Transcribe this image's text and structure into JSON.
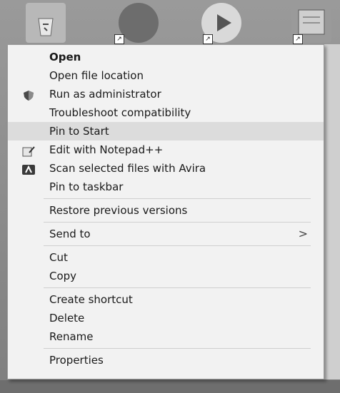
{
  "desktop": {
    "icons": [
      "recycle-bin-icon",
      "app-shortcut-icon",
      "media-shortcut-icon",
      "document-shortcut-icon"
    ]
  },
  "context_menu": {
    "items": [
      {
        "label": "Open"
      },
      {
        "label": "Open file location"
      },
      {
        "label": "Run as administrator",
        "icon": "shield-icon"
      },
      {
        "label": "Troubleshoot compatibility"
      },
      {
        "label": "Pin to Start"
      },
      {
        "label": "Edit with Notepad++",
        "icon": "notepad-plus-plus-icon"
      },
      {
        "label": "Scan selected files with Avira",
        "icon": "avira-icon"
      },
      {
        "label": "Pin to taskbar"
      },
      {
        "label": "Restore previous versions"
      },
      {
        "label": "Send to",
        "submenu_arrow": ">"
      },
      {
        "label": "Cut"
      },
      {
        "label": "Copy"
      },
      {
        "label": "Create shortcut"
      },
      {
        "label": "Delete"
      },
      {
        "label": "Rename"
      },
      {
        "label": "Properties"
      }
    ]
  }
}
